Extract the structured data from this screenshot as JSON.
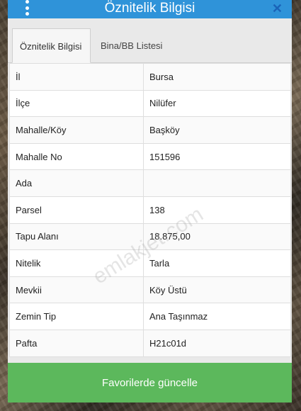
{
  "header": {
    "title": "Öznitelik Bilgisi"
  },
  "tabs": [
    {
      "label": "Öznitelik Bilgisi",
      "active": true
    },
    {
      "label": "Bina/BB Listesi",
      "active": false
    }
  ],
  "attributes": [
    {
      "key": "İl",
      "value": "Bursa"
    },
    {
      "key": "İlçe",
      "value": "Nilüfer"
    },
    {
      "key": "Mahalle/Köy",
      "value": "Başköy"
    },
    {
      "key": "Mahalle No",
      "value": "151596"
    },
    {
      "key": "Ada",
      "value": ""
    },
    {
      "key": "Parsel",
      "value": "138"
    },
    {
      "key": "Tapu Alanı",
      "value": "18.875,00"
    },
    {
      "key": "Nitelik",
      "value": "Tarla"
    },
    {
      "key": "Mevkii",
      "value": "Köy Üstü"
    },
    {
      "key": "Zemin Tip",
      "value": "Ana Taşınmaz"
    },
    {
      "key": "Pafta",
      "value": "H21c01d"
    }
  ],
  "footer": {
    "button_label": "Favorilerde güncelle"
  },
  "watermark": "emlakjet.com",
  "colors": {
    "header": "#2f93d9",
    "button": "#5cb85c",
    "close": "#1a63b8"
  },
  "icons": {
    "menu": "menu-dots-icon",
    "close": "close-icon"
  }
}
